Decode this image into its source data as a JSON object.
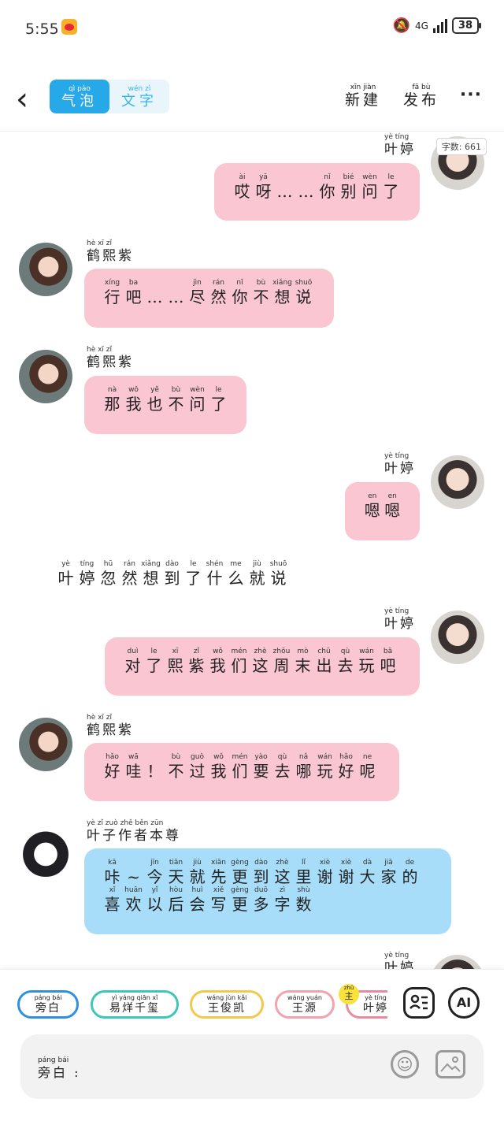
{
  "status": {
    "time": "5:55",
    "network": "4G",
    "battery": "38"
  },
  "topbar": {
    "tabs": [
      {
        "py": "qì pào",
        "hz": "气泡"
      },
      {
        "py": "wén zì",
        "hz": "文字"
      }
    ],
    "new_py": "xīn jiàn",
    "new_hz": "新建",
    "publish_py": "fā bù",
    "publish_hz": "发布",
    "more": "···"
  },
  "word_count": {
    "label": "字数:",
    "label_py": "zì shù",
    "value": "661"
  },
  "messages": [
    {
      "side": "right",
      "name_py": "yè tíng",
      "name": "叶婷",
      "lines": [
        [
          [
            "ài",
            "哎"
          ],
          [
            "yā",
            "呀"
          ],
          [
            "",
            "…"
          ],
          [
            "",
            "…"
          ],
          [
            "nǐ",
            "你"
          ],
          [
            "bié",
            "别"
          ],
          [
            "wèn",
            "问"
          ],
          [
            "le",
            "了"
          ]
        ]
      ]
    },
    {
      "side": "left",
      "name_py": "hè xī zǐ",
      "name": "鹤熙紫",
      "lines": [
        [
          [
            "xíng",
            "行"
          ],
          [
            "ba",
            "吧"
          ],
          [
            "",
            "…"
          ],
          [
            "",
            "…"
          ],
          [
            "jìn",
            "尽"
          ],
          [
            "rán",
            "然"
          ],
          [
            "nǐ",
            "你"
          ],
          [
            "bù",
            "不"
          ],
          [
            "xiǎng",
            "想"
          ],
          [
            "shuō",
            "说"
          ]
        ]
      ]
    },
    {
      "side": "left",
      "name_py": "hè xī zǐ",
      "name": "鹤熙紫",
      "lines": [
        [
          [
            "nà",
            "那"
          ],
          [
            "wǒ",
            "我"
          ],
          [
            "yě",
            "也"
          ],
          [
            "bù",
            "不"
          ],
          [
            "wèn",
            "问"
          ],
          [
            "le",
            "了"
          ]
        ]
      ]
    },
    {
      "side": "right",
      "name_py": "yè tíng",
      "name": "叶婷",
      "lines": [
        [
          [
            "en",
            "嗯"
          ],
          [
            "en",
            "嗯"
          ]
        ]
      ]
    },
    {
      "side": "narration",
      "lines": [
        [
          [
            "yè",
            "叶"
          ],
          [
            "tíng",
            "婷"
          ],
          [
            "hū",
            "忽"
          ],
          [
            "rán",
            "然"
          ],
          [
            "xiǎng",
            "想"
          ],
          [
            "dào",
            "到"
          ],
          [
            "le",
            "了"
          ],
          [
            "shén",
            "什"
          ],
          [
            "me",
            "么"
          ],
          [
            "jiù",
            "就"
          ],
          [
            "shuō",
            "说"
          ]
        ]
      ]
    },
    {
      "side": "right",
      "name_py": "yè tíng",
      "name": "叶婷",
      "lines": [
        [
          [
            "duì",
            "对"
          ],
          [
            "le",
            "了"
          ],
          [
            "xī",
            "熙"
          ],
          [
            "zǐ",
            "紫"
          ],
          [
            "wǒ",
            "我"
          ],
          [
            "mén",
            "们"
          ],
          [
            "zhè",
            "这"
          ],
          [
            "zhōu",
            "周"
          ],
          [
            "mò",
            "末"
          ],
          [
            "chū",
            "出"
          ],
          [
            "qù",
            "去"
          ],
          [
            "wán",
            "玩"
          ],
          [
            "bā",
            "吧"
          ]
        ]
      ]
    },
    {
      "side": "left",
      "name_py": "hè xī zǐ",
      "name": "鹤熙紫",
      "lines": [
        [
          [
            "hǎo",
            "好"
          ],
          [
            "wā",
            "哇"
          ],
          [
            "",
            "！"
          ],
          [
            "bù",
            "不"
          ],
          [
            "guò",
            "过"
          ],
          [
            "wǒ",
            "我"
          ],
          [
            "mén",
            "们"
          ],
          [
            "yào",
            "要"
          ],
          [
            "qù",
            "去"
          ],
          [
            "nǎ",
            "哪"
          ],
          [
            "wán",
            "玩"
          ],
          [
            "hǎo",
            "好"
          ],
          [
            "ne",
            "呢"
          ]
        ]
      ]
    },
    {
      "side": "left",
      "name_py": "yè zǐ zuò zhě běn zūn",
      "name": "叶子作者本尊",
      "lines": [
        [
          [
            "kā",
            "咔"
          ],
          [
            "",
            "~"
          ],
          [
            "jīn",
            "今"
          ],
          [
            "tiān",
            "天"
          ],
          [
            "jiù",
            "就"
          ],
          [
            "xiān",
            "先"
          ],
          [
            "gèng",
            "更"
          ],
          [
            "dào",
            "到"
          ],
          [
            "zhè",
            "这"
          ],
          [
            "lǐ",
            "里"
          ],
          [
            "xiè",
            "谢"
          ],
          [
            "xiè",
            "谢"
          ],
          [
            "dà",
            "大"
          ],
          [
            "jiā",
            "家"
          ],
          [
            "de",
            "的"
          ]
        ],
        [
          [
            "xǐ",
            "喜"
          ],
          [
            "huān",
            "欢"
          ],
          [
            "yǐ",
            "以"
          ],
          [
            "hòu",
            "后"
          ],
          [
            "huì",
            "会"
          ],
          [
            "xiě",
            "写"
          ],
          [
            "gèng",
            "更"
          ],
          [
            "duō",
            "多"
          ],
          [
            "zì",
            "字"
          ],
          [
            "shù",
            "数"
          ]
        ]
      ]
    },
    {
      "side": "right",
      "name_py": "yè tíng",
      "name": "叶婷",
      "lines": []
    }
  ],
  "characters": [
    {
      "py": "páng bái",
      "hz": "旁白",
      "color": "#2f8fe0"
    },
    {
      "py": "yì yáng qiān xǐ",
      "hz": "易烊千玺",
      "color": "#3cc7b6"
    },
    {
      "py": "wáng jùn kǎi",
      "hz": "王俊凯",
      "color": "#f2c94c"
    },
    {
      "py": "wáng yuán",
      "hz": "王源",
      "color": "#f2a3ad"
    },
    {
      "py": "yè tíng",
      "hz": "叶婷",
      "color": "#e98aa0"
    }
  ],
  "main_badge": {
    "py": "zhǔ",
    "hz": "主"
  },
  "ai_label": "AI",
  "input": {
    "speaker_py": "páng bái",
    "speaker_hz": "旁白 :"
  },
  "colors": {
    "accent": "#27a8e8",
    "pink_bubble": "#f9c6d2",
    "blue_bubble": "#a7ddf8"
  }
}
